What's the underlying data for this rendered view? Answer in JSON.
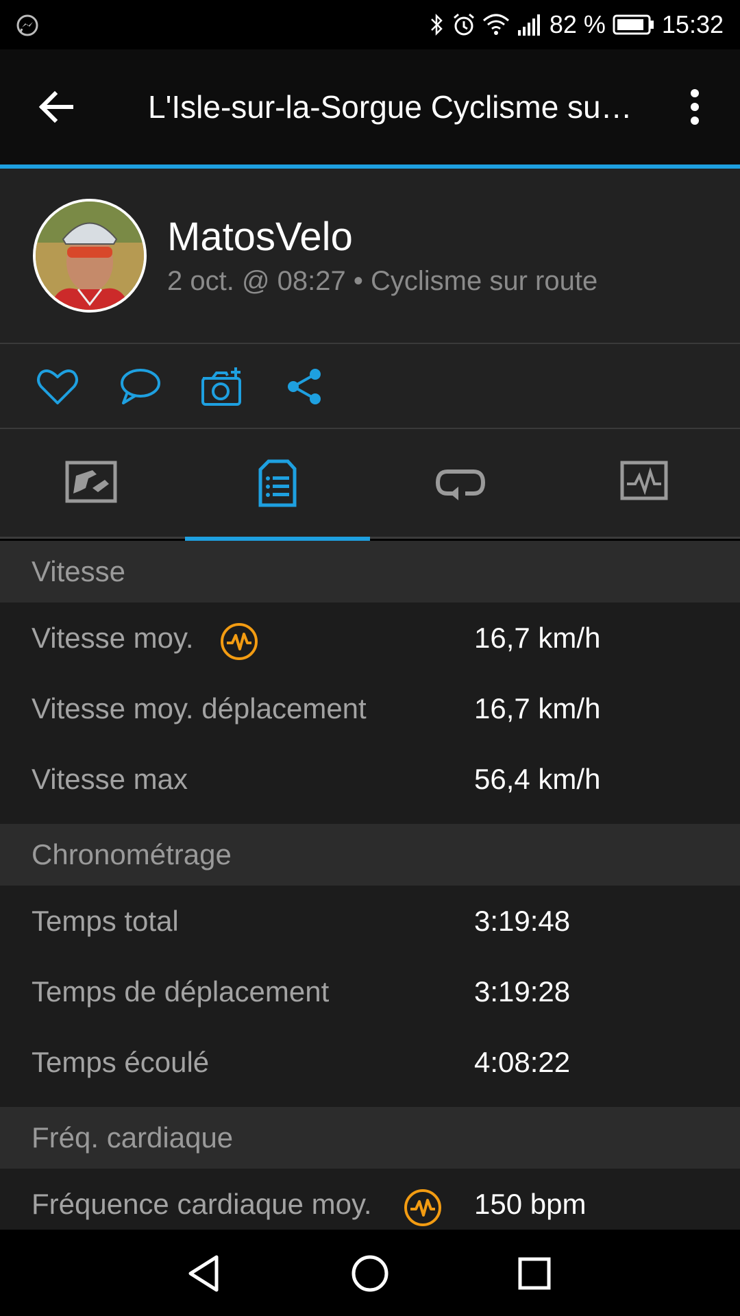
{
  "status_bar": {
    "battery_percent": "82 %",
    "time": "15:32",
    "icons": [
      "messenger-icon",
      "bluetooth-icon",
      "alarm-icon",
      "wifi-icon",
      "signal-icon",
      "battery-icon"
    ]
  },
  "app_bar": {
    "title": "L'Isle-sur-la-Sorgue Cyclisme su…",
    "back_icon": "arrow-left-icon",
    "more_icon": "more-vert-icon"
  },
  "profile": {
    "username": "MatosVelo",
    "meta": "2 oct. @ 08:27 • Cyclisme sur route"
  },
  "actions": [
    "heart-icon",
    "comment-icon",
    "add-photo-icon",
    "share-icon"
  ],
  "tabs": [
    {
      "icon": "map-icon",
      "active": false
    },
    {
      "icon": "details-icon",
      "active": true
    },
    {
      "icon": "laps-icon",
      "active": false
    },
    {
      "icon": "chart-icon",
      "active": false
    }
  ],
  "sections": {
    "speed": {
      "title": "Vitesse",
      "rows": [
        {
          "label": "Vitesse moy.",
          "value": "16,7 km/h",
          "badge": "insight-icon"
        },
        {
          "label": "Vitesse moy. déplacement",
          "value": "16,7 km/h"
        },
        {
          "label": "Vitesse max",
          "value": "56,4 km/h"
        }
      ]
    },
    "timing": {
      "title": "Chronométrage",
      "rows": [
        {
          "label": "Temps total",
          "value": "3:19:48"
        },
        {
          "label": "Temps de déplacement",
          "value": "3:19:28"
        },
        {
          "label": "Temps écoulé",
          "value": "4:08:22"
        }
      ]
    },
    "heart": {
      "title": "Fréq. cardiaque",
      "rows": [
        {
          "label": "Fréquence cardiaque moy.",
          "value": "150 bpm",
          "badge": "insight-icon"
        }
      ]
    }
  },
  "colors": {
    "accent": "#1ea0e0",
    "badge": "#f39c12",
    "section_bg": "#2c2c2c",
    "row_bg": "#1c1c1c"
  },
  "nav_bar": [
    "back-triangle-icon",
    "home-circle-icon",
    "recents-square-icon"
  ]
}
